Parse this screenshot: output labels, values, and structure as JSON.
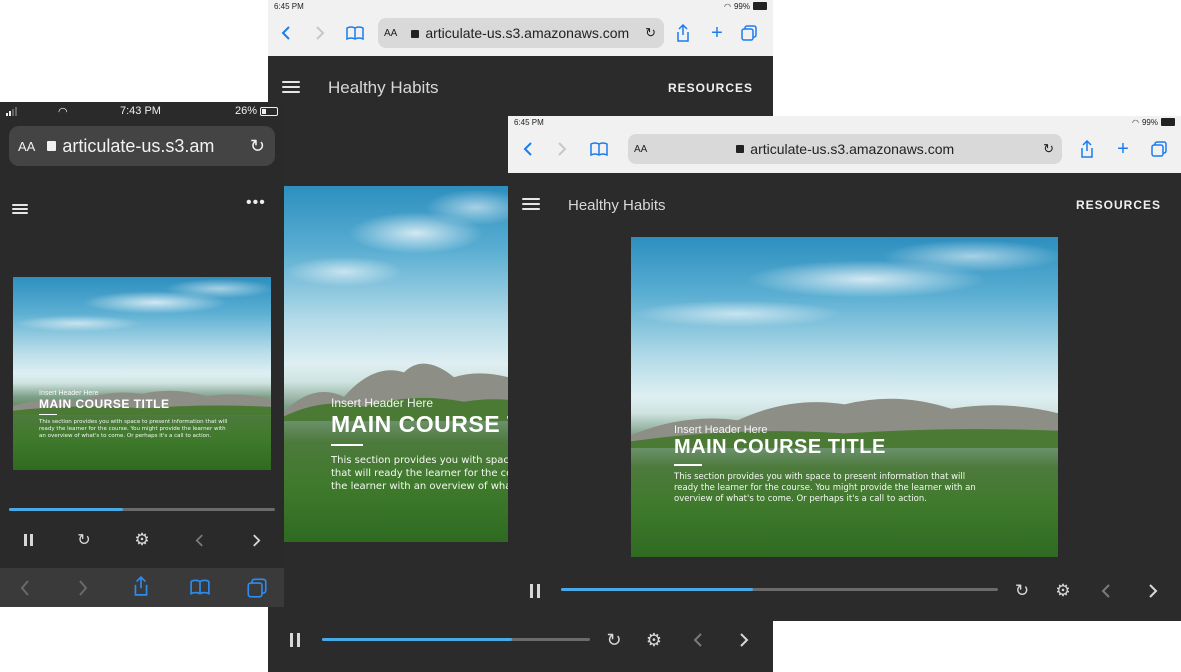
{
  "phone": {
    "status": {
      "time": "7:43 PM",
      "battery": "26%"
    },
    "url": "articulate-us.s3.am",
    "aa": "AA",
    "slide": {
      "header": "Insert Header Here",
      "title": "MAIN COURSE TITLE",
      "body": "This section provides you with space to present information that will ready the learner for the course. You might provide the learner with an overview of what's to come. Or perhaps it's a call to action."
    },
    "progress": 0.43
  },
  "tablet_portrait": {
    "status": {
      "time": "6:45 PM",
      "battery": "99%"
    },
    "url": "articulate-us.s3.amazonaws.com",
    "aa": "AA",
    "app_title": "Healthy Habits",
    "resources": "RESOURCES",
    "slide": {
      "header": "Insert Header Here",
      "title": "MAIN COURSE TITLE",
      "body": "This section provides you with space to present information that will ready the learner for the course. You might provide the learner with an overview of what's to come. Or perhaps it's a call to action."
    },
    "progress": 0.71
  },
  "tablet_landscape": {
    "status": {
      "time": "6:45 PM",
      "battery": "99%"
    },
    "url": "articulate-us.s3.amazonaws.com",
    "aa": "AA",
    "app_title": "Healthy Habits",
    "resources": "RESOURCES",
    "slide": {
      "header": "Insert Header Here",
      "title": "MAIN COURSE TITLE",
      "body": "This section provides you with space to present information that will ready the learner for the course. You might provide the learner with an overview of what's to come. Or perhaps it's a call to action."
    },
    "progress": 0.44
  },
  "colors": {
    "accent": "#47a9e6",
    "safari_blue": "#1a7cf0",
    "player_bg": "#2b2b2b"
  }
}
